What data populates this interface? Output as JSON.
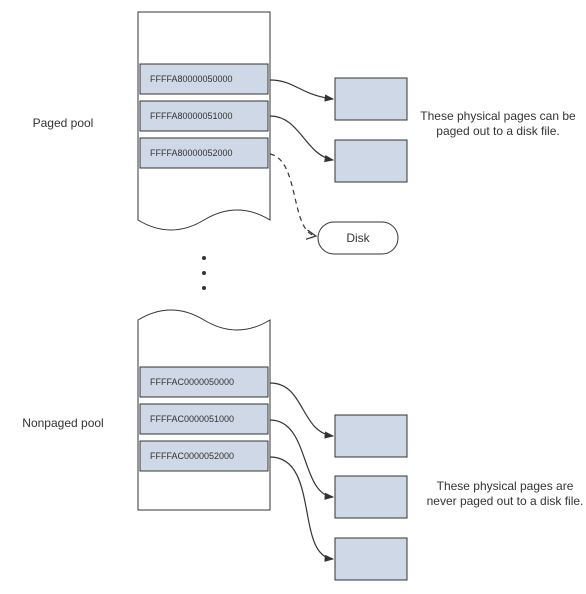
{
  "paged": {
    "label": "Paged pool",
    "addresses": [
      "FFFFA80000050000",
      "FFFFA80000051000",
      "FFFFA80000052000"
    ],
    "caption_line1": "These physical pages can be",
    "caption_line2": "paged out to a disk file.",
    "disk_label": "Disk"
  },
  "nonpaged": {
    "label": "Nonpaged pool",
    "addresses": [
      "FFFFAC0000050000",
      "FFFFAC0000051000",
      "FFFFAC0000052000"
    ],
    "caption_line1": "These physical pages are",
    "caption_line2": "never paged out to a disk file."
  }
}
